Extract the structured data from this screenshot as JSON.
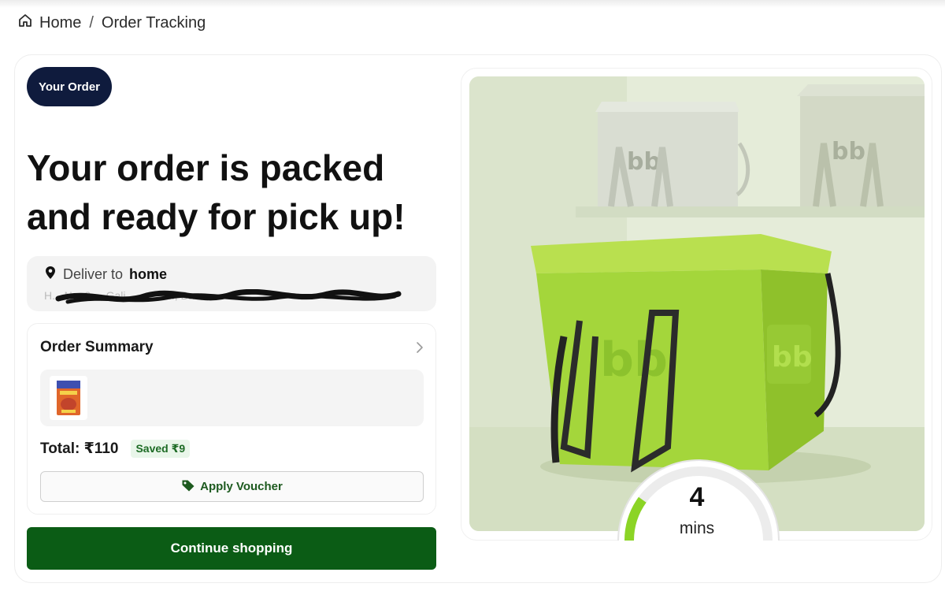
{
  "breadcrumb": {
    "home": "Home",
    "separator": "/",
    "current": "Order Tracking"
  },
  "order": {
    "badge": "Your Order",
    "headline": "Your order is packed and ready for pick up!"
  },
  "delivery": {
    "prefix": "Deliver to",
    "label": "home",
    "address_visible": "H...   No. 2...,   Gali...,   ...   ...   ..., Ba... ..."
  },
  "summary": {
    "title": "Order Summary",
    "total": "Total: ₹110",
    "saved": "Saved ₹9",
    "voucher_label": "Apply Voucher"
  },
  "actions": {
    "continue_label": "Continue shopping"
  },
  "timer": {
    "value": "4",
    "unit": "mins",
    "progress": 0.2
  },
  "colors": {
    "badge_bg": "#0f1b3d",
    "primary_green": "#0b5c15",
    "saved_green": "#1d6b25",
    "bag_green": "#a4d63b",
    "timer_green": "#8bd425",
    "illustration_bg": "#dfe8cf"
  },
  "icons": {
    "home": "home-icon",
    "location": "location-pin-icon",
    "chevron": "chevron-right-icon",
    "voucher": "tag-icon"
  }
}
